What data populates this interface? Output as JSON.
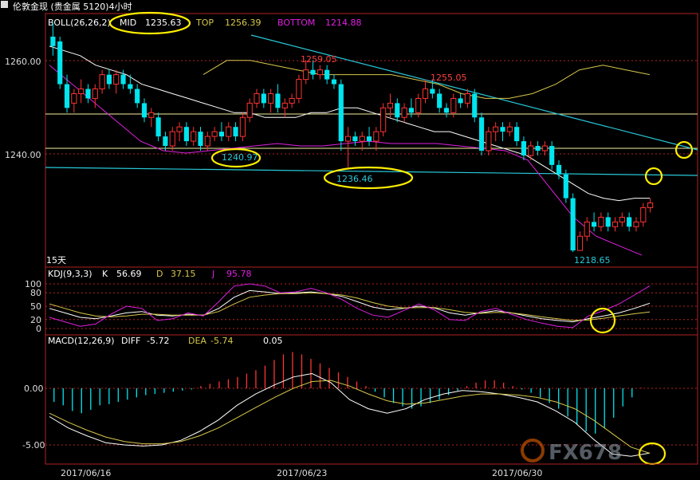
{
  "window": {
    "title": "伦敦金现 (贵金属 5120)4小时"
  },
  "colors": {
    "background": "#000000",
    "frame": "#b22222",
    "up_candle": "#ff3333",
    "down_candle": "#00e5ee",
    "mid_line": "#ffffff",
    "top_line": "#d8c84a",
    "bottom_line": "#e020e0",
    "trend_line": "#28c8d8",
    "highlight": "#ffee00"
  },
  "main_panel": {
    "indicator": "BOLL(26,26,2)",
    "mid_label": "MID",
    "mid_value": "1235.63",
    "top_label": "TOP",
    "top_value": "1256.39",
    "bottom_label": "BOTTOM",
    "bottom_value": "1214.88",
    "y_ticks": [
      "1260.00",
      "1240.00"
    ],
    "annotations": [
      "1259.05",
      "1255.05",
      "1240.97",
      "1236.46",
      "1218.65"
    ],
    "period_label": "15天"
  },
  "kdj_panel": {
    "indicator": "KDJ(9,3,3)",
    "k_label": "K",
    "k_value": "56.69",
    "d_label": "D",
    "d_value": "37.15",
    "j_label": "J",
    "j_value": "95.78",
    "y_ticks": [
      "100",
      "80",
      "50",
      "20",
      "0"
    ]
  },
  "macd_panel": {
    "indicator": "MACD(12,26,9)",
    "diff_label": "DIFF",
    "diff_value": "-5.72",
    "dea_label": "DEA",
    "dea_value": "-5.74",
    "macd_value": "0.05",
    "y_ticks": [
      "0.00",
      "-5.00"
    ]
  },
  "x_axis": {
    "labels": [
      "2017/06/16",
      "2017/06/23",
      "2017/06/30"
    ]
  },
  "watermark": "FX678",
  "chart_data": {
    "type": "candlestick",
    "title": "伦敦金现 (贵金属 5120)4小时",
    "ylim": [
      1216,
      1265
    ],
    "y_ticks": [
      1260,
      1240
    ],
    "x_tick_labels": [
      "2017/06/16",
      "2017/06/23",
      "2017/06/30"
    ],
    "candles": [
      [
        1264,
        1267,
        1260,
        1262
      ],
      [
        1263,
        1264,
        1253,
        1254
      ],
      [
        1254,
        1256,
        1248,
        1249
      ],
      [
        1250,
        1253,
        1248,
        1252
      ],
      [
        1252,
        1255,
        1250,
        1253
      ],
      [
        1253,
        1254,
        1250,
        1251
      ],
      [
        1251,
        1254,
        1249,
        1253
      ],
      [
        1253,
        1257,
        1252,
        1256
      ],
      [
        1256,
        1257,
        1253,
        1254
      ],
      [
        1254,
        1257,
        1252,
        1256
      ],
      [
        1256,
        1257,
        1253,
        1254
      ],
      [
        1254,
        1256,
        1252,
        1253
      ],
      [
        1253,
        1254,
        1249,
        1250
      ],
      [
        1250,
        1251,
        1246,
        1247
      ],
      [
        1247,
        1249,
        1245,
        1248
      ],
      [
        1247,
        1248,
        1242,
        1243
      ],
      [
        1243,
        1244,
        1240,
        1241
      ],
      [
        1241,
        1245,
        1240,
        1244
      ],
      [
        1244,
        1246,
        1242,
        1245
      ],
      [
        1245,
        1246,
        1241,
        1242
      ],
      [
        1242,
        1245,
        1241,
        1244
      ],
      [
        1244,
        1245,
        1240,
        1241
      ],
      [
        1241,
        1244,
        1240,
        1243
      ],
      [
        1243,
        1245,
        1242,
        1244
      ],
      [
        1244,
        1246,
        1242,
        1243
      ],
      [
        1243,
        1246,
        1242,
        1245
      ],
      [
        1245,
        1246,
        1242,
        1243
      ],
      [
        1243,
        1248,
        1242,
        1247
      ],
      [
        1247,
        1251,
        1246,
        1250
      ],
      [
        1250,
        1253,
        1249,
        1252
      ],
      [
        1252,
        1253,
        1249,
        1250
      ],
      [
        1250,
        1253,
        1248,
        1252
      ],
      [
        1252,
        1254,
        1248,
        1249
      ],
      [
        1249,
        1251,
        1247,
        1250
      ],
      [
        1250,
        1252,
        1249,
        1251
      ],
      [
        1251,
        1256,
        1250,
        1255
      ],
      [
        1255,
        1259,
        1254,
        1257
      ],
      [
        1257,
        1259,
        1255,
        1256
      ],
      [
        1256,
        1258,
        1255,
        1257
      ],
      [
        1257,
        1258,
        1254,
        1255
      ],
      [
        1255,
        1256,
        1253,
        1254
      ],
      [
        1254,
        1255,
        1240,
        1242
      ],
      [
        1242,
        1245,
        1236.5,
        1243
      ],
      [
        1243,
        1244,
        1241,
        1242
      ],
      [
        1242,
        1244,
        1240,
        1243
      ],
      [
        1243,
        1245,
        1241,
        1242
      ],
      [
        1242,
        1245,
        1240,
        1244
      ],
      [
        1244,
        1250,
        1243,
        1249
      ],
      [
        1249,
        1252,
        1247,
        1250
      ],
      [
        1250,
        1251,
        1246,
        1247
      ],
      [
        1247,
        1250,
        1246,
        1249
      ],
      [
        1249,
        1251,
        1247,
        1248
      ],
      [
        1248,
        1252,
        1247,
        1251
      ],
      [
        1251,
        1255,
        1250,
        1253
      ],
      [
        1253,
        1255,
        1251,
        1252
      ],
      [
        1252,
        1253,
        1248,
        1249
      ],
      [
        1249,
        1250,
        1247,
        1248
      ],
      [
        1248,
        1252,
        1247,
        1251
      ],
      [
        1251,
        1252,
        1249,
        1250
      ],
      [
        1250,
        1253,
        1249,
        1252
      ],
      [
        1252,
        1253,
        1246,
        1247
      ],
      [
        1247,
        1248,
        1239,
        1240
      ],
      [
        1240,
        1245,
        1239,
        1244
      ],
      [
        1244,
        1246,
        1242,
        1245
      ],
      [
        1245,
        1246,
        1242,
        1244
      ],
      [
        1244,
        1246,
        1243,
        1245
      ],
      [
        1245,
        1246,
        1241,
        1242
      ],
      [
        1242,
        1243,
        1238,
        1239
      ],
      [
        1239,
        1242,
        1238,
        1241
      ],
      [
        1241,
        1242,
        1239,
        1240
      ],
      [
        1240,
        1242,
        1239,
        1241
      ],
      [
        1241,
        1242,
        1236,
        1237
      ],
      [
        1237,
        1238,
        1234,
        1235
      ],
      [
        1235,
        1236,
        1229,
        1230
      ],
      [
        1230,
        1231,
        1218.65,
        1219
      ],
      [
        1219,
        1223,
        1219,
        1222
      ],
      [
        1222,
        1226,
        1221,
        1225
      ],
      [
        1225,
        1227,
        1223,
        1224
      ],
      [
        1224,
        1227,
        1223,
        1226
      ],
      [
        1226,
        1227,
        1223,
        1224
      ],
      [
        1224,
        1226,
        1223,
        1225
      ],
      [
        1225,
        1227,
        1224,
        1226
      ],
      [
        1226,
        1227,
        1223,
        1224
      ],
      [
        1224,
        1226,
        1223,
        1225
      ],
      [
        1225,
        1229,
        1224,
        1228
      ],
      [
        1228,
        1230,
        1227,
        1229
      ]
    ],
    "mid": [
      1262,
      1261,
      1260,
      1258,
      1257,
      1256,
      1254,
      1253,
      1252,
      1251,
      1250,
      1249,
      1248,
      1248,
      1247,
      1247,
      1247,
      1248,
      1248,
      1249,
      1249,
      1248,
      1247,
      1246,
      1245,
      1244,
      1244,
      1243,
      1242,
      1241,
      1240,
      1239,
      1237,
      1235,
      1233,
      1231,
      1230,
      1229.5,
      1230,
      1230
    ],
    "top": [
      1256,
      1259,
      1259,
      1258,
      1257,
      1256,
      1256,
      1256,
      1256,
      1255,
      1254,
      1252,
      1251,
      1251,
      1252,
      1254,
      1257,
      1258,
      1257,
      1256
    ],
    "bottom": [
      1258,
      1254,
      1250,
      1246,
      1242,
      1240,
      1239.5,
      1240,
      1240.5,
      1241,
      1241.5,
      1241,
      1241,
      1241.5,
      1242,
      1241.5,
      1241.5,
      1241.5,
      1241,
      1240.5,
      1240,
      1238,
      1232,
      1226,
      1222,
      1220,
      1218
    ],
    "kdj": {
      "ylim": [
        0,
        100
      ],
      "y_ticks": [
        100,
        80,
        50,
        20,
        0
      ],
      "k": [
        45,
        35,
        25,
        22,
        28,
        35,
        38,
        30,
        28,
        32,
        30,
        45,
        70,
        85,
        82,
        78,
        80,
        82,
        78,
        72,
        60,
        48,
        42,
        45,
        50,
        46,
        35,
        30,
        35,
        40,
        35,
        28,
        22,
        18,
        15,
        22,
        28,
        35,
        45,
        56.69
      ],
      "d": [
        55,
        45,
        35,
        28,
        26,
        28,
        32,
        32,
        30,
        30,
        30,
        38,
        55,
        70,
        75,
        78,
        78,
        80,
        78,
        75,
        68,
        58,
        50,
        46,
        47,
        47,
        42,
        36,
        34,
        36,
        35,
        31,
        26,
        22,
        18,
        19,
        23,
        28,
        33,
        37.15
      ],
      "j": [
        25,
        15,
        5,
        10,
        32,
        50,
        45,
        18,
        22,
        35,
        28,
        60,
        95,
        100,
        95,
        80,
        82,
        90,
        80,
        65,
        45,
        30,
        25,
        40,
        55,
        42,
        20,
        18,
        38,
        45,
        32,
        20,
        12,
        5,
        2,
        28,
        40,
        55,
        75,
        95.78
      ]
    },
    "macd": {
      "ylim": [
        -6,
        3
      ],
      "y_ticks": [
        0,
        -5
      ],
      "diff": [
        -2.5,
        -3.5,
        -4.2,
        -4.8,
        -5.0,
        -5.1,
        -5.0,
        -4.6,
        -3.8,
        -2.8,
        -1.5,
        -0.5,
        0.3,
        1.0,
        1.3,
        0.5,
        -1.0,
        -1.8,
        -2.2,
        -1.8,
        -1.0,
        -0.5,
        -0.2,
        -0.3,
        -0.5,
        -0.8,
        -1.2,
        -2.0,
        -3.0,
        -4.5,
        -5.8,
        -6.0,
        -5.72
      ],
      "dea": [
        -2.2,
        -3.0,
        -3.7,
        -4.3,
        -4.7,
        -4.9,
        -4.9,
        -4.7,
        -4.2,
        -3.5,
        -2.6,
        -1.7,
        -0.8,
        0.0,
        0.6,
        0.7,
        0.2,
        -0.5,
        -1.1,
        -1.4,
        -1.3,
        -1.0,
        -0.7,
        -0.5,
        -0.5,
        -0.6,
        -0.8,
        -1.2,
        -1.8,
        -2.8,
        -4.0,
        -5.2,
        -5.74
      ],
      "hist": [
        -1.2,
        -1.5,
        -2.0,
        -2.2,
        -1.9,
        -1.5,
        -1.4,
        -1.2,
        -1.0,
        -0.8,
        -0.6,
        -0.5,
        -0.4,
        -0.3,
        -0.2,
        -0.1,
        0.2,
        0.4,
        0.6,
        0.8,
        1.0,
        1.3,
        1.6,
        2.0,
        2.5,
        3.0,
        3.2,
        3.0,
        2.6,
        2.2,
        1.8,
        1.4,
        1.0,
        0.6,
        0.2,
        -0.3,
        -0.8,
        -1.3,
        -1.6,
        -1.8,
        -1.6,
        -1.3,
        -1.0,
        -0.6,
        -0.2,
        0.2,
        0.5,
        0.7,
        0.7,
        0.5,
        0.2,
        -0.1,
        -0.4,
        -0.8,
        -1.3,
        -1.8,
        -2.5,
        -3.2,
        -3.8,
        -4.0,
        -3.5,
        -2.6,
        -1.6,
        -0.8,
        0.05
      ]
    }
  }
}
